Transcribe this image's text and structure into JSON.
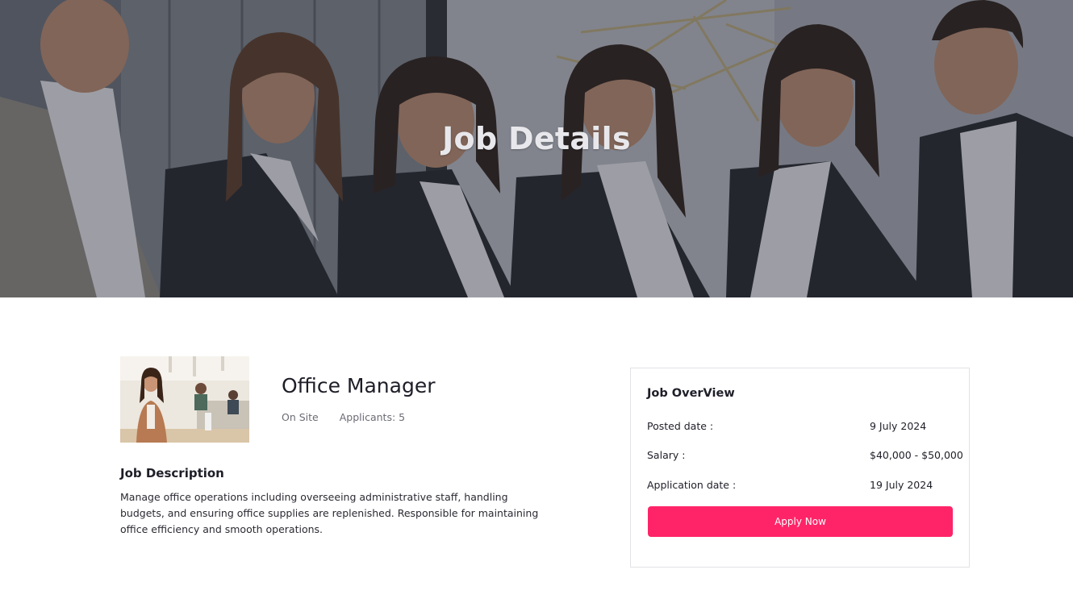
{
  "hero": {
    "title": "Job Details"
  },
  "job": {
    "title": "Office Manager",
    "work_type": "On Site",
    "applicants": "Applicants: 5"
  },
  "description": {
    "heading": "Job Description",
    "text": "Manage office operations including overseeing administrative staff, handling budgets, and ensuring office supplies are replenished. Responsible for maintaining office efficiency and smooth operations."
  },
  "overview": {
    "title": "Job OverView",
    "rows": [
      {
        "label": "Posted date :",
        "value": "9 July 2024"
      },
      {
        "label": "Salary :",
        "value": "$40,000 - $50,000"
      },
      {
        "label": "Application date :",
        "value": "19 July 2024"
      }
    ],
    "apply_label": "Apply Now"
  },
  "colors": {
    "accent": "#ff2468",
    "hero_overlay": "#3f434b",
    "text": "#1e1e28"
  }
}
